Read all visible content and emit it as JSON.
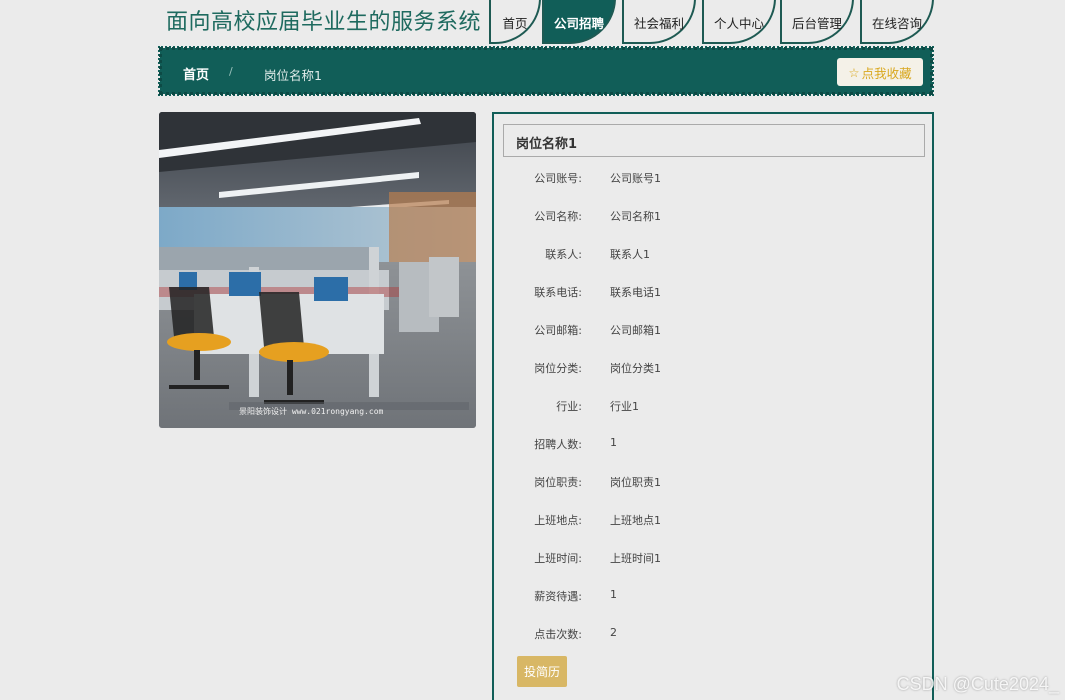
{
  "header": {
    "site_title": "面向高校应届毕业生的服务系统",
    "nav": [
      "首页",
      "公司招聘",
      "社会福利",
      "个人中心",
      "后台管理",
      "在线咨询"
    ],
    "active_index": 1
  },
  "breadcrumb": {
    "home": "首页",
    "separator": "/",
    "current": "岗位名称1",
    "favorite_label": "点我收藏",
    "favorite_icon": "star-outline-icon"
  },
  "detail": {
    "title": "岗位名称1",
    "fields": [
      {
        "label": "公司账号:",
        "value": "公司账号1"
      },
      {
        "label": "公司名称:",
        "value": "公司名称1"
      },
      {
        "label": "联系人:",
        "value": "联系人1"
      },
      {
        "label": "联系电话:",
        "value": "联系电话1"
      },
      {
        "label": "公司邮箱:",
        "value": "公司邮箱1"
      },
      {
        "label": "岗位分类:",
        "value": "岗位分类1"
      },
      {
        "label": "行业:",
        "value": "行业1"
      },
      {
        "label": "招聘人数:",
        "value": "1"
      },
      {
        "label": "岗位职责:",
        "value": "岗位职责1"
      },
      {
        "label": "上班地点:",
        "value": "上班地点1"
      },
      {
        "label": "上班时间:",
        "value": "上班时间1"
      },
      {
        "label": "薪资待遇:",
        "value": "1"
      },
      {
        "label": "点击次数:",
        "value": "2"
      }
    ],
    "apply_label": "投简历"
  },
  "photo": {
    "watermark_text": "景阳装饰设计 www.021rongyang.com"
  },
  "watermark": "CSDN @Cute2024_",
  "colors": {
    "primary": "#115e58",
    "title": "#1e6a5f",
    "favorite_text": "#d9a81f",
    "apply_button": "#d8b765",
    "background": "#ebebeb"
  }
}
